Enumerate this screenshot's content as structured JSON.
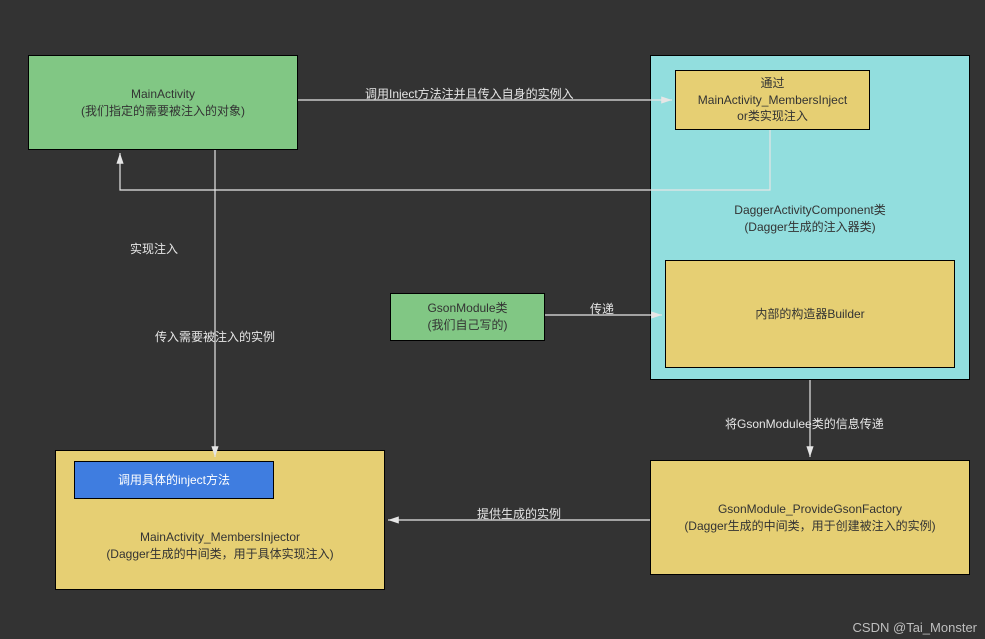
{
  "nodes": {
    "mainActivity": {
      "title": "MainActivity",
      "subtitle": "(我们指定的需要被注入的对象)"
    },
    "membersInjectorTop": {
      "line1": "通过",
      "line2": "MainActivity_MembersInject",
      "line3": "or类实现注入"
    },
    "daggerComponent": {
      "title": "DaggerActivityComponent类",
      "subtitle": "(Dagger生成的注入器类)"
    },
    "gsonModule": {
      "title": "GsonModule类",
      "subtitle": "(我们自己写的)"
    },
    "builder": "内部的构造器Builder",
    "injectMethod": "调用具体的inject方法",
    "membersInjectorBottom": {
      "title": "MainActivity_MembersInjector",
      "subtitle": "(Dagger生成的中间类，用于具体实现注入)"
    },
    "gsonFactory": {
      "title": "GsonModule_ProvideGsonFactory",
      "subtitle": "(Dagger生成的中间类，用于创建被注入的实例)"
    }
  },
  "edges": {
    "callInject": "调用Inject方法注并且传入自身的实例入",
    "implInject": "实现注入",
    "passInstance": "传入需要被注入的实例",
    "pass": "传递",
    "passGsonModule": "将GsonModulee类的信息传递",
    "provideInstance": "提供生成的实例"
  },
  "watermark": "CSDN @Tai_Monster"
}
